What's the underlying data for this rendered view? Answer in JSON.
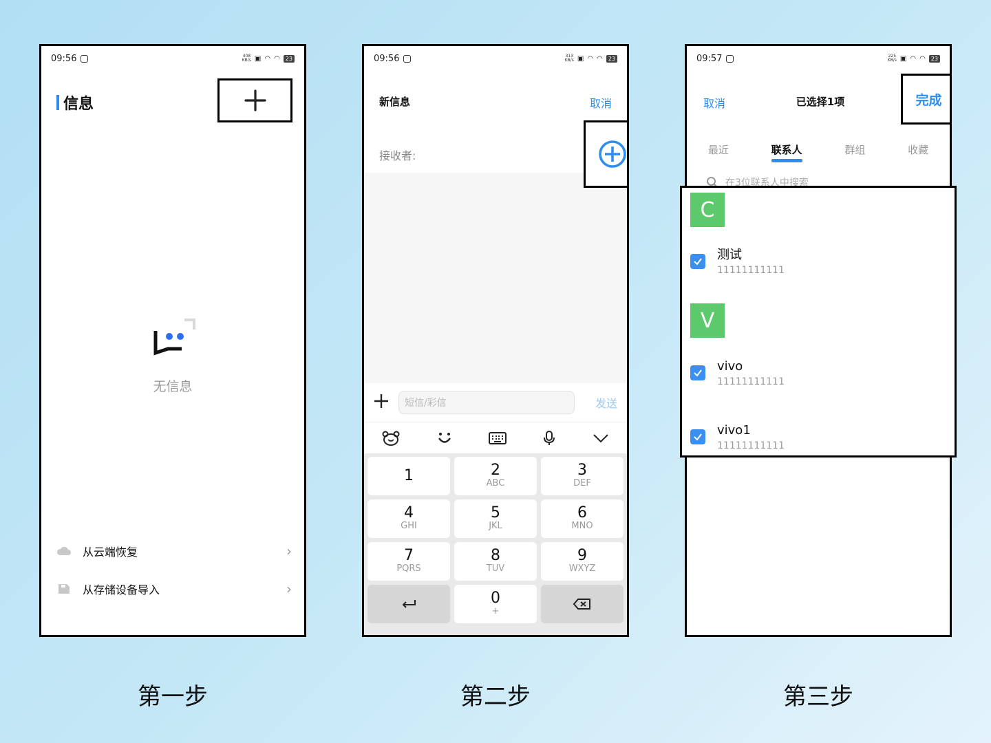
{
  "steps": [
    {
      "caption": "第一步",
      "status": {
        "time": "09:56",
        "speed_top": "408",
        "speed_bottom": "KB/s",
        "battery": "23"
      },
      "title": "信息",
      "empty_text": "无信息",
      "restore_label": "从云端恢复",
      "import_label": "从存储设备导入"
    },
    {
      "caption": "第二步",
      "status": {
        "time": "09:56",
        "speed_top": "313",
        "speed_bottom": "KB/s",
        "battery": "23"
      },
      "title": "新信息",
      "cancel_label": "取消",
      "recipient_label": "接收者:",
      "input_placeholder": "短信/彩信",
      "send_label": "发送",
      "keys": [
        {
          "d": "1",
          "l": ""
        },
        {
          "d": "2",
          "l": "ABC"
        },
        {
          "d": "3",
          "l": "DEF"
        },
        {
          "d": "4",
          "l": "GHI"
        },
        {
          "d": "5",
          "l": "JKL"
        },
        {
          "d": "6",
          "l": "MNO"
        },
        {
          "d": "7",
          "l": "PQRS"
        },
        {
          "d": "8",
          "l": "TUV"
        },
        {
          "d": "9",
          "l": "WXYZ"
        },
        {
          "d": "",
          "l": ""
        },
        {
          "d": "0",
          "l": "+"
        },
        {
          "d": "",
          "l": ""
        }
      ]
    },
    {
      "caption": "第三步",
      "status": {
        "time": "09:57",
        "speed_top": "225",
        "speed_bottom": "KB/s",
        "battery": "23"
      },
      "cancel_label": "取消",
      "title": "已选择1项",
      "done_label": "完成",
      "tabs": [
        "最近",
        "联系人",
        "群组",
        "收藏"
      ],
      "search_placeholder": "在3位联系人中搜索",
      "groups": [
        {
          "letter": "C",
          "contacts": [
            {
              "name": "测试",
              "number": "11111111111"
            }
          ]
        },
        {
          "letter": "V",
          "contacts": [
            {
              "name": "vivo",
              "number": "11111111111"
            },
            {
              "name": "vivo1",
              "number": "11111111111"
            }
          ]
        }
      ]
    }
  ],
  "colors": {
    "accent": "#2e8ef0",
    "letter_badge": "#5cc96c"
  }
}
